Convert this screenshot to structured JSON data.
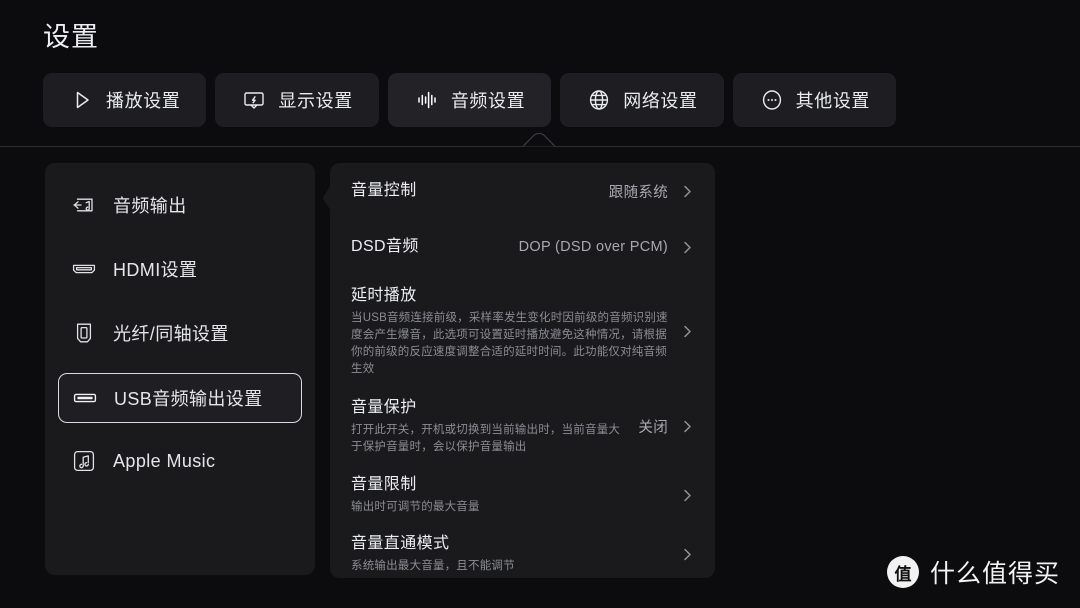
{
  "header": {
    "title": "设置",
    "tabs": [
      {
        "label": "播放设置",
        "icon": "play-icon",
        "active": false
      },
      {
        "label": "显示设置",
        "icon": "display-icon",
        "active": false
      },
      {
        "label": "音频设置",
        "icon": "audio-waveform-icon",
        "active": true
      },
      {
        "label": "网络设置",
        "icon": "globe-icon",
        "active": false
      },
      {
        "label": "其他设置",
        "icon": "ellipsis-circle-icon",
        "active": false
      }
    ]
  },
  "sidebar": {
    "items": [
      {
        "label": "音频输出",
        "icon": "audio-output-icon",
        "selected": false
      },
      {
        "label": "HDMI设置",
        "icon": "hdmi-port-icon",
        "selected": false
      },
      {
        "label": "光纤/同轴设置",
        "icon": "optical-coax-icon",
        "selected": false
      },
      {
        "label": "USB音频输出设置",
        "icon": "usb-port-icon",
        "selected": true
      },
      {
        "label": "Apple Music",
        "icon": "music-note-icon",
        "selected": false
      }
    ]
  },
  "content": {
    "rows": [
      {
        "title": "音量控制",
        "desc": "",
        "value": "跟随系统",
        "chevron": "chevron-right-icon"
      },
      {
        "title": "DSD音频",
        "desc": "",
        "value": "DOP (DSD over PCM)",
        "chevron": "chevron-right-icon"
      },
      {
        "title": "延时播放",
        "desc": "当USB音频连接前级，采样率发生变化时因前级的音频识别速度会产生爆音，此选项可设置延时播放避免这种情况，请根据你的前级的反应速度调整合适的延时时间。此功能仅对纯音频生效",
        "value": "",
        "chevron": "chevron-right-icon"
      },
      {
        "title": "音量保护",
        "desc": "打开此开关，开机或切换到当前输出时，当前音量大于保护音量时，会以保护音量输出",
        "value": "关闭",
        "chevron": "chevron-right-icon"
      },
      {
        "title": "音量限制",
        "desc": "输出时可调节的最大音量",
        "value": "",
        "chevron": "chevron-right-icon"
      },
      {
        "title": "音量直通模式",
        "desc": "系统输出最大音量，且不能调节",
        "value": "",
        "chevron": "chevron-right-icon"
      }
    ]
  },
  "watermark": {
    "badge": "值",
    "text": "什么值得买"
  },
  "colors": {
    "background": "#0c0c0f",
    "panel": "#1a1a1d",
    "tab": "#1e1e22",
    "tab_active": "#232327",
    "text_primary": "#eceef2",
    "text_secondary": "#a7a9af",
    "text_muted": "#8b8d93",
    "selection_border": "#d9dade"
  }
}
